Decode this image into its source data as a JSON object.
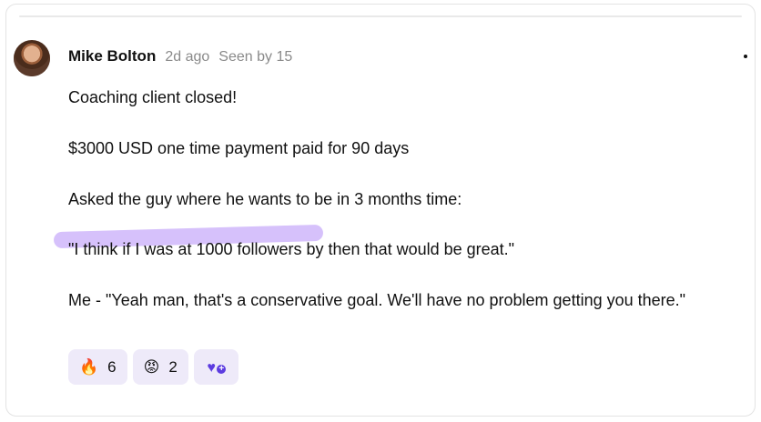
{
  "post": {
    "author": "Mike Bolton",
    "time": "2d ago",
    "seen": "Seen by 15",
    "lines": {
      "l1": "Coaching client closed!",
      "l2_highlight": "$3000 USD one time payment",
      "l2_rest": " paid for 90 days",
      "l3": "Asked the guy where he wants to be in 3 months time:",
      "l4": "\"I think if I was at 1000 followers by then that would be great.\"",
      "l5": "Me - \"Yeah man, that's a conservative goal. We'll have no problem getting you there.\""
    }
  },
  "reactions": [
    {
      "emoji": "🔥",
      "icon": "fire-icon",
      "count": "6"
    },
    {
      "emoji": "😡",
      "icon": "angry-face-icon",
      "count": "2"
    }
  ],
  "colors": {
    "highlight": "#d6c1fb",
    "reaction_bg": "#eeeaf9",
    "accent": "#5c3ce0"
  }
}
